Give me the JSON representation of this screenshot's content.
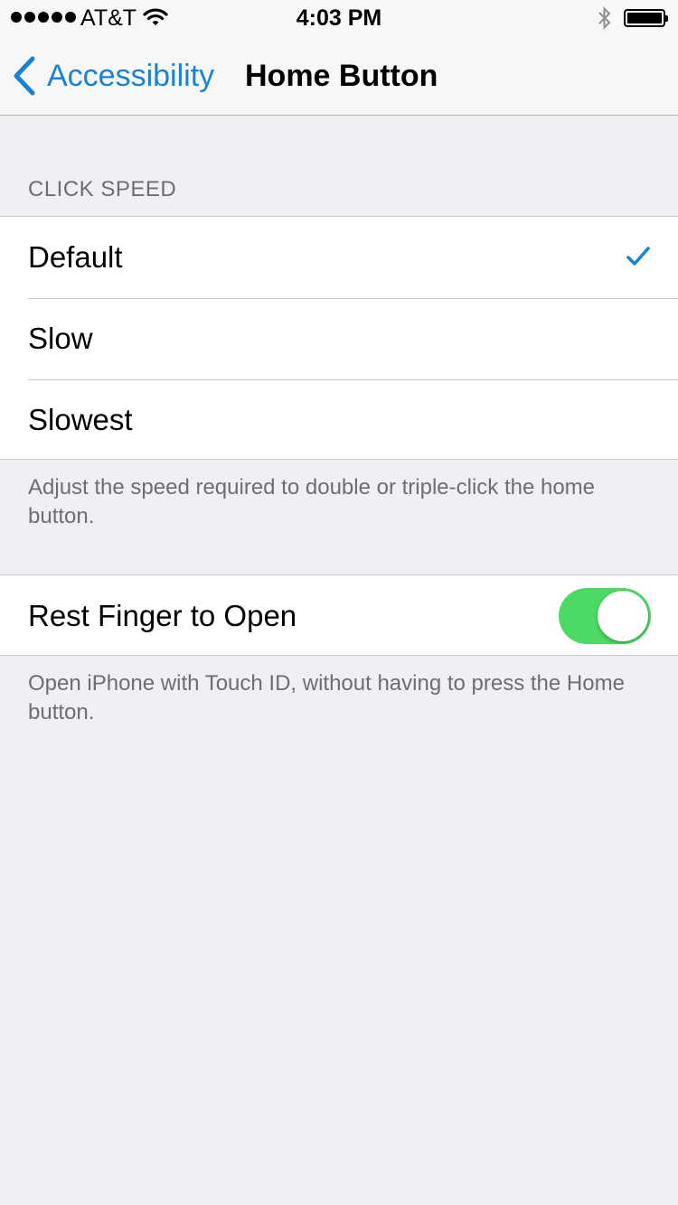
{
  "status_bar": {
    "carrier": "AT&T",
    "time": "4:03 PM",
    "signal_icon": "signal-dots-icon",
    "wifi_icon": "wifi-icon",
    "bluetooth_icon": "bluetooth-icon",
    "battery_icon": "battery-icon",
    "battery_level": 1.0
  },
  "nav": {
    "back_label": "Accessibility",
    "title": "Home Button"
  },
  "click_speed": {
    "header": "CLICK SPEED",
    "options": [
      {
        "label": "Default",
        "selected": true
      },
      {
        "label": "Slow",
        "selected": false
      },
      {
        "label": "Slowest",
        "selected": false
      }
    ],
    "footer": "Adjust the speed required to double or triple-click the home button."
  },
  "rest_finger": {
    "label": "Rest Finger to Open",
    "enabled": true,
    "footer": "Open iPhone with Touch ID, without having to press the Home button."
  },
  "colors": {
    "accent": "#1a82d4",
    "toggle_on": "#4cd964",
    "background": "#efeff4",
    "secondary_text": "#6d6d72"
  }
}
